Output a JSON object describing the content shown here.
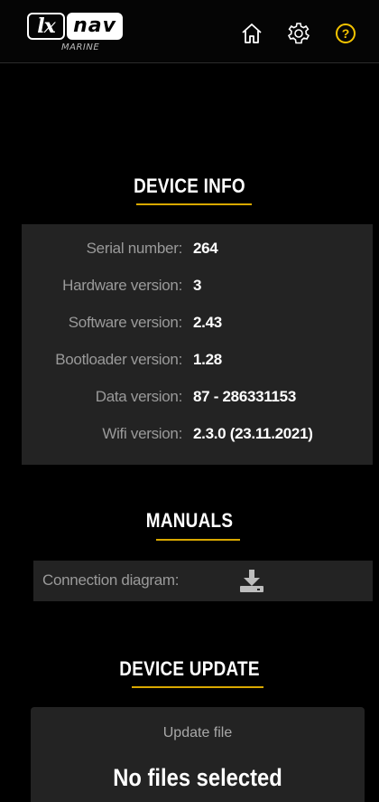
{
  "header": {
    "logo_lx": "lx",
    "logo_nav": "nav",
    "logo_sub": "MARINE",
    "icons": [
      "home-icon",
      "gear-icon",
      "help-icon"
    ],
    "accent_color": "#f5c400"
  },
  "device_info": {
    "title": "DEVICE INFO",
    "rows": [
      {
        "label": "Serial number:",
        "value": "264"
      },
      {
        "label": "Hardware version:",
        "value": "3"
      },
      {
        "label": "Software version:",
        "value": "2.43"
      },
      {
        "label": "Bootloader version:",
        "value": "1.28"
      },
      {
        "label": "Data version:",
        "value": "87 - 286331153"
      },
      {
        "label": "Wifi version:",
        "value": "2.3.0 (23.11.2021)"
      }
    ]
  },
  "manuals": {
    "title": "MANUALS",
    "connection_label": "Connection diagram:",
    "download_icon": "download-icon"
  },
  "device_update": {
    "title": "DEVICE UPDATE",
    "upload_label": "Update file",
    "files_status": "No files selected"
  }
}
